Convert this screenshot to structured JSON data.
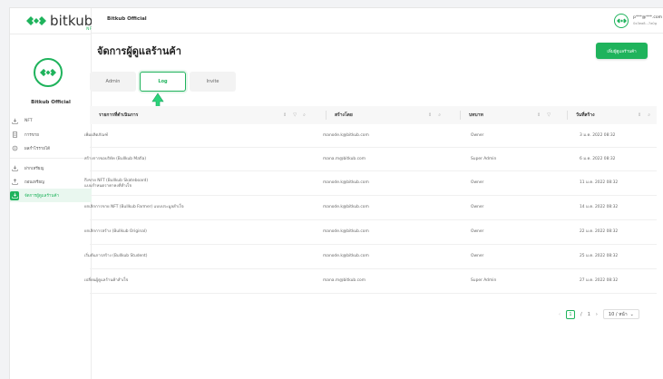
{
  "brand": {
    "name": "bitkub",
    "sub": "NFT",
    "color": "#1fb35c"
  },
  "sidebar": {
    "shop_name": "Bitkub Official",
    "items": [
      {
        "label": "NFT",
        "icon": "download-icon"
      },
      {
        "label": "การขาย",
        "icon": "document-icon"
      },
      {
        "label": "ผลกำไรรายได้",
        "icon": "coin-icon"
      },
      {
        "label": "ฝากเหรียญ",
        "icon": "deposit-icon"
      },
      {
        "label": "ถอนเหรียญ",
        "icon": "withdraw-icon"
      },
      {
        "label": "จัดการผู้ดูแลร้านค้า",
        "icon": "manage-icon",
        "active": true
      }
    ]
  },
  "header": {
    "title": "Bitkub Official",
    "user_email": "p***@***.com",
    "user_sub": "0x3ea8...7a0g"
  },
  "main": {
    "page_title": "จัดการผู้ดูแลร้านค้า",
    "add_button": "เพิ่มผู้ดูแลร้านค้า",
    "tabs": [
      {
        "label": "Admin",
        "active": false
      },
      {
        "label": "Log",
        "active": true
      },
      {
        "label": "Invite",
        "active": false
      }
    ],
    "table": {
      "columns": [
        "รายการที่ดำเนินการ",
        "สร้างโดย",
        "บทบาท",
        "วันที่สร้าง"
      ],
      "rows": [
        {
          "action": "เพิ่มผลิตภัณฑ์",
          "action2": "",
          "by": "manode.k@bitkub.com",
          "role": "Owner",
          "date": "3 ม.ค. 2022 08:32"
        },
        {
          "action": "สร้างการขอบริษัท (Bullkub Mafia)",
          "action2": "",
          "by": "mana.m@bitkub.com",
          "role": "Super Admin",
          "date": "6 ม.ค. 2022 08:32"
        },
        {
          "action": "ถึงขาย NFT (Bullkub Skateboard)",
          "action2": "แบบกำหนดราคาคงที่สำเร็จ",
          "by": "manode.k@bitkub.com",
          "role": "Owner",
          "date": "11 ม.ค. 2022 08:32"
        },
        {
          "action": "ยกเลิกการขาย NFT (Bullkub Farmer) แบบประมูลสำเร็จ",
          "action2": "",
          "by": "manode.k@bitkub.com",
          "role": "Owner",
          "date": "14 ม.ค. 2022 08:32"
        },
        {
          "action": "ยกเลิกการสร้าง (Bullkub Original)",
          "action2": "",
          "by": "manode.k@bitkub.com",
          "role": "Owner",
          "date": "22 ม.ค. 2022 08:32"
        },
        {
          "action": "เริ่มต้นการสร้าง (Bullkub Student)",
          "action2": "",
          "by": "manode.k@bitkub.com",
          "role": "Owner",
          "date": "25 ม.ค. 2022 08:32"
        },
        {
          "action": "เปลี่ยนผู้ดูแลร้านค้าสำเร็จ",
          "action2": "",
          "by": "mana.m@bitkub.com",
          "role": "Super Admin",
          "date": "27 ม.ค. 2022 08:32"
        }
      ]
    },
    "pagination": {
      "current": "1",
      "sep": "/",
      "total": "1",
      "page_size": "10 / หน้า"
    }
  }
}
